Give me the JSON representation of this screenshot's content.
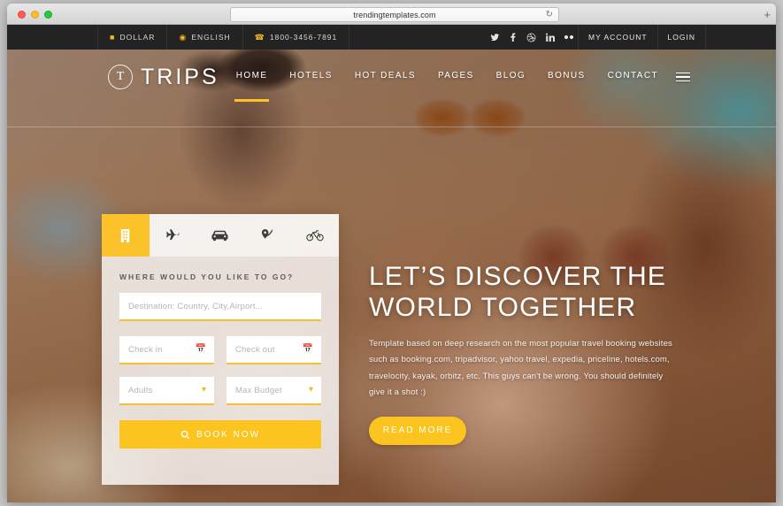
{
  "browser": {
    "url": "trendingtemplates.com",
    "reload_icon": "reload-icon",
    "newtab_icon": "+"
  },
  "topbar": {
    "left_items": [
      {
        "icon": "wallet-icon",
        "glyph": "■",
        "label": "DOLLAR"
      },
      {
        "icon": "globe-icon",
        "glyph": "◉",
        "label": "ENGLISH"
      },
      {
        "icon": "phone-icon",
        "glyph": "✆",
        "label": "1800-3456-7891"
      }
    ],
    "social": [
      {
        "name": "twitter-icon"
      },
      {
        "name": "facebook-icon"
      },
      {
        "name": "dribbble-icon"
      },
      {
        "name": "linkedin-icon"
      },
      {
        "name": "flickr-icon"
      }
    ],
    "links": [
      {
        "label": "MY ACCOUNT"
      },
      {
        "label": "LOGIN"
      }
    ]
  },
  "header": {
    "logo_letter": "T",
    "logo_text": "TRIPS",
    "nav": [
      {
        "label": "HOME",
        "active": true
      },
      {
        "label": "HOTELS",
        "active": false
      },
      {
        "label": "HOT DEALS",
        "active": false
      },
      {
        "label": "PAGES",
        "active": false
      },
      {
        "label": "BLOG",
        "active": false
      },
      {
        "label": "BONUS",
        "active": false
      },
      {
        "label": "CONTACT",
        "active": false
      }
    ]
  },
  "booking": {
    "tabs": [
      {
        "icon": "hotel-icon",
        "active": true
      },
      {
        "icon": "airplane-icon",
        "active": false
      },
      {
        "icon": "car-icon",
        "active": false
      },
      {
        "icon": "map-pin-icon",
        "active": false
      },
      {
        "icon": "bicycle-icon",
        "active": false
      }
    ],
    "heading": "WHERE WOULD YOU LIKE TO GO?",
    "destination_placeholder": "Destination: Country, City,Airport...",
    "checkin_placeholder": "Check in",
    "checkout_placeholder": "Check out",
    "adults_placeholder": "Adults",
    "budget_placeholder": "Max Budget",
    "book_button_label": "BOOK NOW"
  },
  "hero": {
    "title_line1": "LET’S DISCOVER THE",
    "title_line2": "WORLD TOGETHER",
    "paragraph": "Template based on deep research on the most popular travel booking websites such as booking.com, tripadvisor, yahoo travel, expedia, priceline, hotels.com, travelocity, kayak, orbitz, etc. This guys can't be wrong. You should definitely give it a shot :)",
    "read_more_label": "READ MORE"
  },
  "colors": {
    "accent": "#fcc41f",
    "topbar_bg": "#232323",
    "panel_bg": "rgba(255,255,255,0.78)"
  }
}
